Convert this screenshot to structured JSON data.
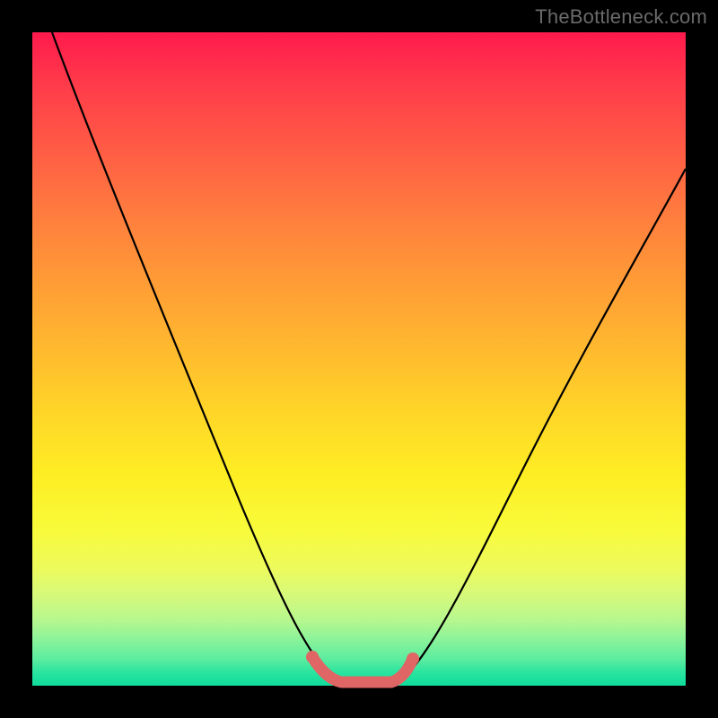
{
  "watermark": "TheBottleneck.com",
  "colors": {
    "frame": "#000000",
    "curve": "#000000",
    "highlight": "#e06666",
    "gradient_top": "#ff1a4d",
    "gradient_bottom": "#0fdc9c"
  },
  "chart_data": {
    "type": "line",
    "title": "",
    "xlabel": "",
    "ylabel": "",
    "xlim": [
      0,
      100
    ],
    "ylim": [
      0,
      100
    ],
    "grid": false,
    "legend": false,
    "notes": "Two smooth black curves descending from top edges to a near-flat bottom section; pink thick overlay highlights the minimum region between the two curve bottoms.",
    "series": [
      {
        "name": "left-curve",
        "x": [
          3,
          8,
          14,
          22,
          30,
          37,
          42,
          45,
          47
        ],
        "values": [
          100,
          86,
          71,
          53,
          35,
          19,
          8,
          2,
          0.5
        ]
      },
      {
        "name": "right-curve",
        "x": [
          56,
          59,
          63,
          70,
          80,
          92,
          100
        ],
        "values": [
          0.5,
          3,
          9,
          21,
          40,
          63,
          79
        ]
      },
      {
        "name": "bottom-highlight",
        "x": [
          43,
          45,
          47,
          50,
          53,
          55,
          57
        ],
        "values": [
          4,
          1.2,
          0.6,
          0.5,
          0.6,
          1.2,
          4
        ]
      }
    ]
  }
}
